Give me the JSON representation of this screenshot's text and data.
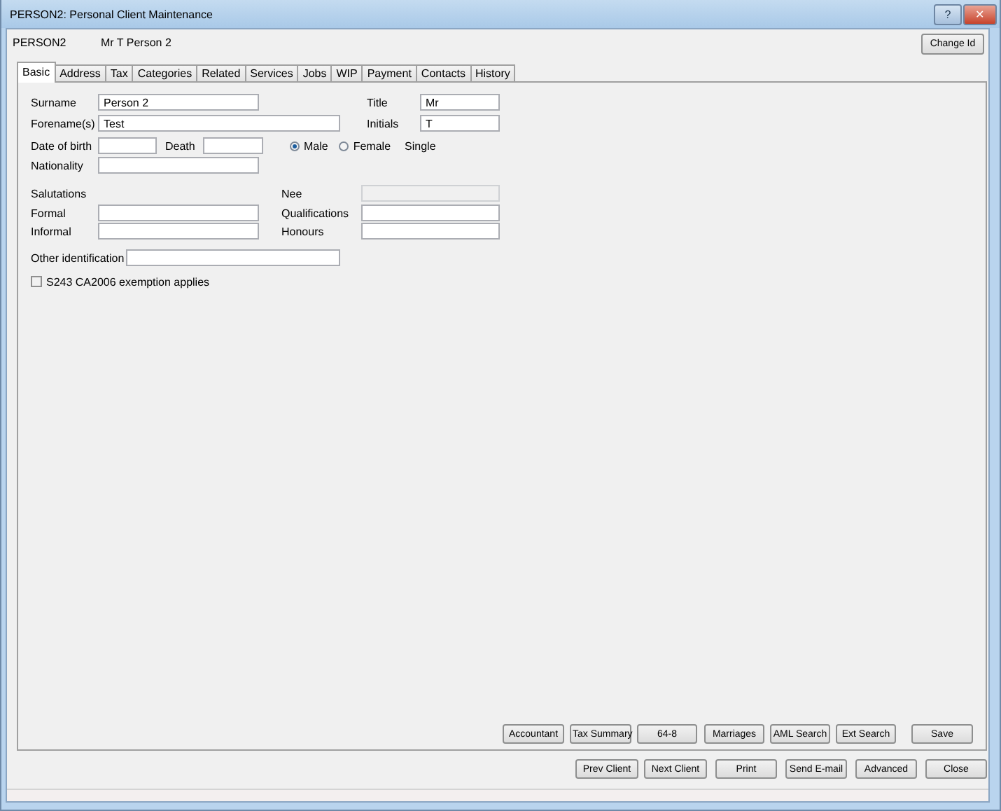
{
  "window": {
    "title": "PERSON2: Personal Client Maintenance",
    "buttons": [
      "?",
      "✕"
    ]
  },
  "header": {
    "code": "PERSON2",
    "name": "Mr T Person 2",
    "change_button": "Change Id"
  },
  "tabs": [
    {
      "label": "Basic",
      "selected": true
    },
    {
      "label": "Address",
      "selected": false
    },
    {
      "label": "Tax",
      "selected": false
    },
    {
      "label": "Categories",
      "selected": false
    },
    {
      "label": "Related",
      "selected": false
    },
    {
      "label": "Services",
      "selected": false
    },
    {
      "label": "Jobs",
      "selected": false
    },
    {
      "label": "WIP",
      "selected": false
    },
    {
      "label": "Payment",
      "selected": false
    },
    {
      "label": "Contacts",
      "selected": false
    },
    {
      "label": "History",
      "selected": false
    }
  ],
  "basic": {
    "surname": {
      "label": "Surname",
      "value": "Person 2"
    },
    "title": {
      "label": "Title",
      "value": "Mr"
    },
    "forenames": {
      "label": "Forename(s)",
      "value": "Test"
    },
    "initials": {
      "label": "Initials",
      "value": "T"
    },
    "date_of_birth": {
      "label": "Date of birth"
    },
    "death": {
      "label": "Death"
    },
    "gender": [
      {
        "label": "Male",
        "selected": true
      },
      {
        "label": "Female",
        "selected": false
      }
    ],
    "marital_status": "Single",
    "nationality": {
      "label": "Nationality"
    },
    "salutations": "Salutations",
    "nee": {
      "label": "Nee",
      "disabled": true
    },
    "formal": {
      "label": "Formal"
    },
    "qualifications": {
      "label": "Qualifications"
    },
    "informal": {
      "label": "Informal"
    },
    "honours": {
      "label": "Honours"
    },
    "other_identification": {
      "label": "Other identification"
    },
    "exemption": {
      "label": "S243 CA2006 exemption applies",
      "checked": false
    }
  },
  "panel_buttons": [
    "Accountant",
    "Tax Summary",
    "64-8",
    "Marriages",
    "AML Search",
    "Ext Search",
    "Save"
  ],
  "footer_buttons": [
    "Prev Client",
    "Next Client",
    "Print",
    "Send E-mail",
    "Advanced",
    "Close"
  ]
}
